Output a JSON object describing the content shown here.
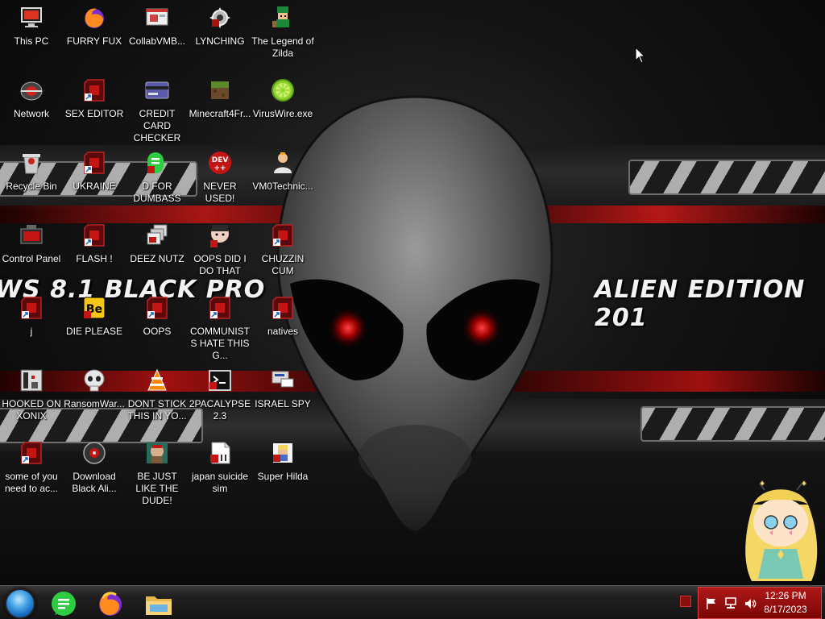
{
  "wallpaper": {
    "left_text": "WS 8.1 BLACK PRO",
    "right_text": "ALIEN EDITION 201"
  },
  "desktop": {
    "icons": [
      {
        "label": "This PC",
        "icon": "computer-icon"
      },
      {
        "label": "FURRY FUX",
        "icon": "firefox-icon"
      },
      {
        "label": "CollabVMB...",
        "icon": "app-window-icon"
      },
      {
        "label": "LYNCHING",
        "icon": "gear-icon"
      },
      {
        "label": "The Legend of Zilda",
        "icon": "game-character-icon"
      },
      {
        "label": "Network",
        "icon": "network-icon"
      },
      {
        "label": "SEX EDITOR",
        "icon": "shortcut-icon"
      },
      {
        "label": "CREDIT CARD CHECKER",
        "icon": "card-icon"
      },
      {
        "label": "Minecraft4Fr...",
        "icon": "minecraft-block-icon"
      },
      {
        "label": "VirusWire.exe",
        "icon": "lime-icon"
      },
      {
        "label": "Recycle Bin",
        "icon": "recycle-bin-icon"
      },
      {
        "label": "UKRAINE",
        "icon": "shortcut-icon"
      },
      {
        "label": "D FOR DUMBASS",
        "icon": "green-d-icon"
      },
      {
        "label": "NEVER USED!",
        "icon": "dev-badge-icon"
      },
      {
        "label": "VM0Technic...",
        "icon": "person-icon"
      },
      {
        "label": "Control Panel",
        "icon": "control-panel-icon"
      },
      {
        "label": "FLASH !",
        "icon": "shortcut-icon"
      },
      {
        "label": "DEEZ NUTZ",
        "icon": "stacked-windows-icon"
      },
      {
        "label": "OOPS DID I DO THAT",
        "icon": "face-icon"
      },
      {
        "label": "CHUZZIN CUM",
        "icon": "shortcut-icon"
      },
      {
        "label": "j",
        "icon": "blank-icon"
      },
      {
        "label": "DIE PLEASE",
        "icon": "behance-icon"
      },
      {
        "label": "OOPS",
        "icon": "shortcut-icon"
      },
      {
        "label": "COMMUNISTS HATE THIS G...",
        "icon": "shortcut-icon"
      },
      {
        "label": "natives",
        "icon": "shortcut-icon"
      },
      {
        "label": "HOOKED ON XONIX",
        "icon": "xonix-icon"
      },
      {
        "label": "RansomWar...",
        "icon": "skull-icon"
      },
      {
        "label": "DONT STICK THIS IN YO...",
        "icon": "vlc-icon"
      },
      {
        "label": "2PACALYPSE 2.3",
        "icon": "terminal-icon"
      },
      {
        "label": "ISRAEL SPY",
        "icon": "spy-icon"
      },
      {
        "label": "some of you need to ac...",
        "icon": "shortcut-icon"
      },
      {
        "label": "Download Black Ali...",
        "icon": "alien-disc-icon"
      },
      {
        "label": "BE JUST LIKE THE DUDE!",
        "icon": "dude-icon"
      },
      {
        "label": "japan suicide sim",
        "icon": "document-icon"
      },
      {
        "label": "Super Hilda",
        "icon": "pixel-art-icon"
      }
    ]
  },
  "taskbar": {
    "apps": [
      {
        "name": "start-button",
        "icon": "start-orb-icon"
      },
      {
        "name": "notes-app",
        "icon": "green-notes-icon"
      },
      {
        "name": "firefox",
        "icon": "firefox-icon"
      },
      {
        "name": "file-explorer",
        "icon": "folder-icon"
      }
    ],
    "clock": {
      "time": "12:26 PM",
      "date": "8/17/2023"
    },
    "tray_icons": [
      "flag-icon",
      "network-icon",
      "speaker-icon"
    ]
  },
  "colors": {
    "tray_bg": "#9a1010",
    "accent_red": "#c41515"
  }
}
